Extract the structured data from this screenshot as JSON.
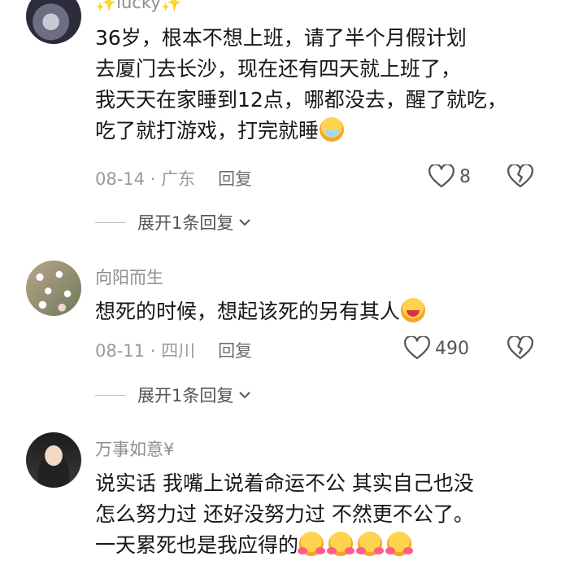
{
  "comments": [
    {
      "username": "✨lucky✨",
      "text": "36岁，根本不想上班，请了半个月假计划\n去厦门去长沙，现在还有四天就上班了，\n我天天在家睡到12点，哪都没去，醒了就吃，\n吃了就打游戏，打完就睡",
      "emojis": [
        "crying-face-emoji"
      ],
      "date": "08-14",
      "location": "广东",
      "reply_label": "回复",
      "likes": "8",
      "expand_label": "展开1条回复"
    },
    {
      "username": "向阳而生",
      "text": "想死的时候，想起该死的另有其人",
      "emojis": [
        "laughing-face-emoji"
      ],
      "date": "08-11",
      "location": "四川",
      "reply_label": "回复",
      "likes": "490",
      "expand_label": "展开1条回复"
    },
    {
      "username": "万事如意¥",
      "text": "说实话 我嘴上说着命运不公 其实自己也没\n怎么努力过 还好没努力过 不然更不公了。\n一天累死也是我应得的",
      "emojis": [
        "hugging-face-emoji",
        "hugging-face-emoji",
        "hugging-face-emoji",
        "hugging-face-emoji"
      ]
    }
  ],
  "separator": " · ",
  "icons": {
    "like": "heart-outline-icon",
    "dislike": "broken-heart-icon",
    "expand": "chevron-down-icon"
  },
  "colors": {
    "text": "#161616",
    "muted": "#9a9a9a",
    "background": "#ffffff"
  }
}
